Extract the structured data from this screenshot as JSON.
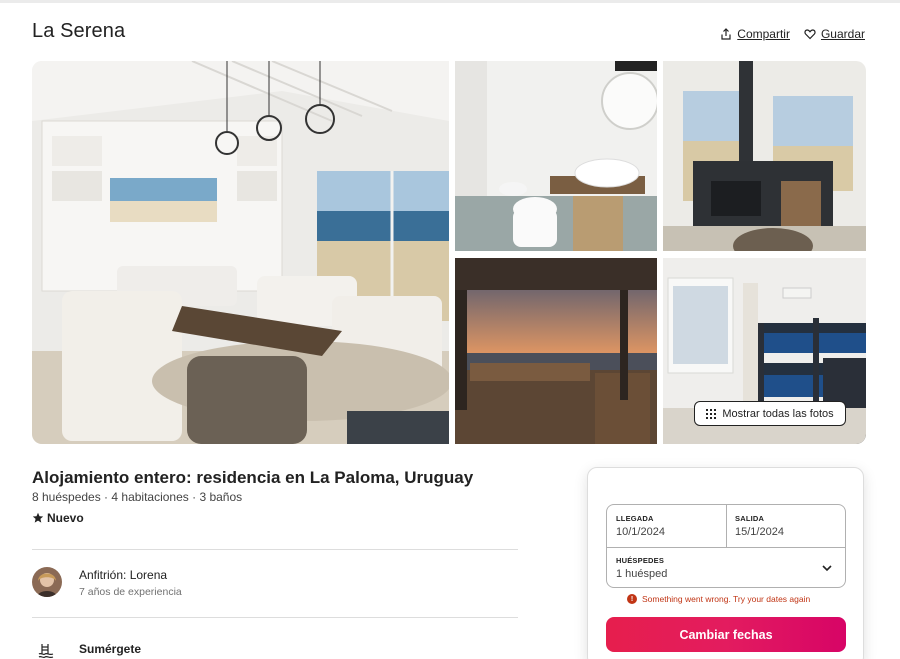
{
  "listing": {
    "title": "La Serena",
    "share_label": "Compartir",
    "save_label": "Guardar",
    "show_all_photos_label": "Mostrar todas las fotos",
    "subtitle": "Alojamiento entero: residencia en La Paloma, Uruguay",
    "details": "8 huéspedes · 4 habitaciones · 3 baños",
    "badge": "Nuevo"
  },
  "host": {
    "name": "Anfitrión: Lorena",
    "experience": "7 años de experiencia"
  },
  "highlight": {
    "label": "Sumérgete"
  },
  "booking": {
    "checkin_label": "LLEGADA",
    "checkin_value": "10/1/2024",
    "checkout_label": "SALIDA",
    "checkout_value": "15/1/2024",
    "guests_label": "HUÉSPEDES",
    "guests_value": "1 huésped",
    "error_text": "Something went wrong. Try your dates again",
    "cta_label": "Cambiar fechas",
    "accent_color": "#e31c5f",
    "error_color": "#c13515"
  },
  "icons": {
    "share": "share-icon",
    "save": "heart-icon",
    "grid": "grid-icon",
    "star": "star-icon",
    "error": "error-icon",
    "chevron": "chevron-down-icon",
    "pool": "pool-icon"
  }
}
